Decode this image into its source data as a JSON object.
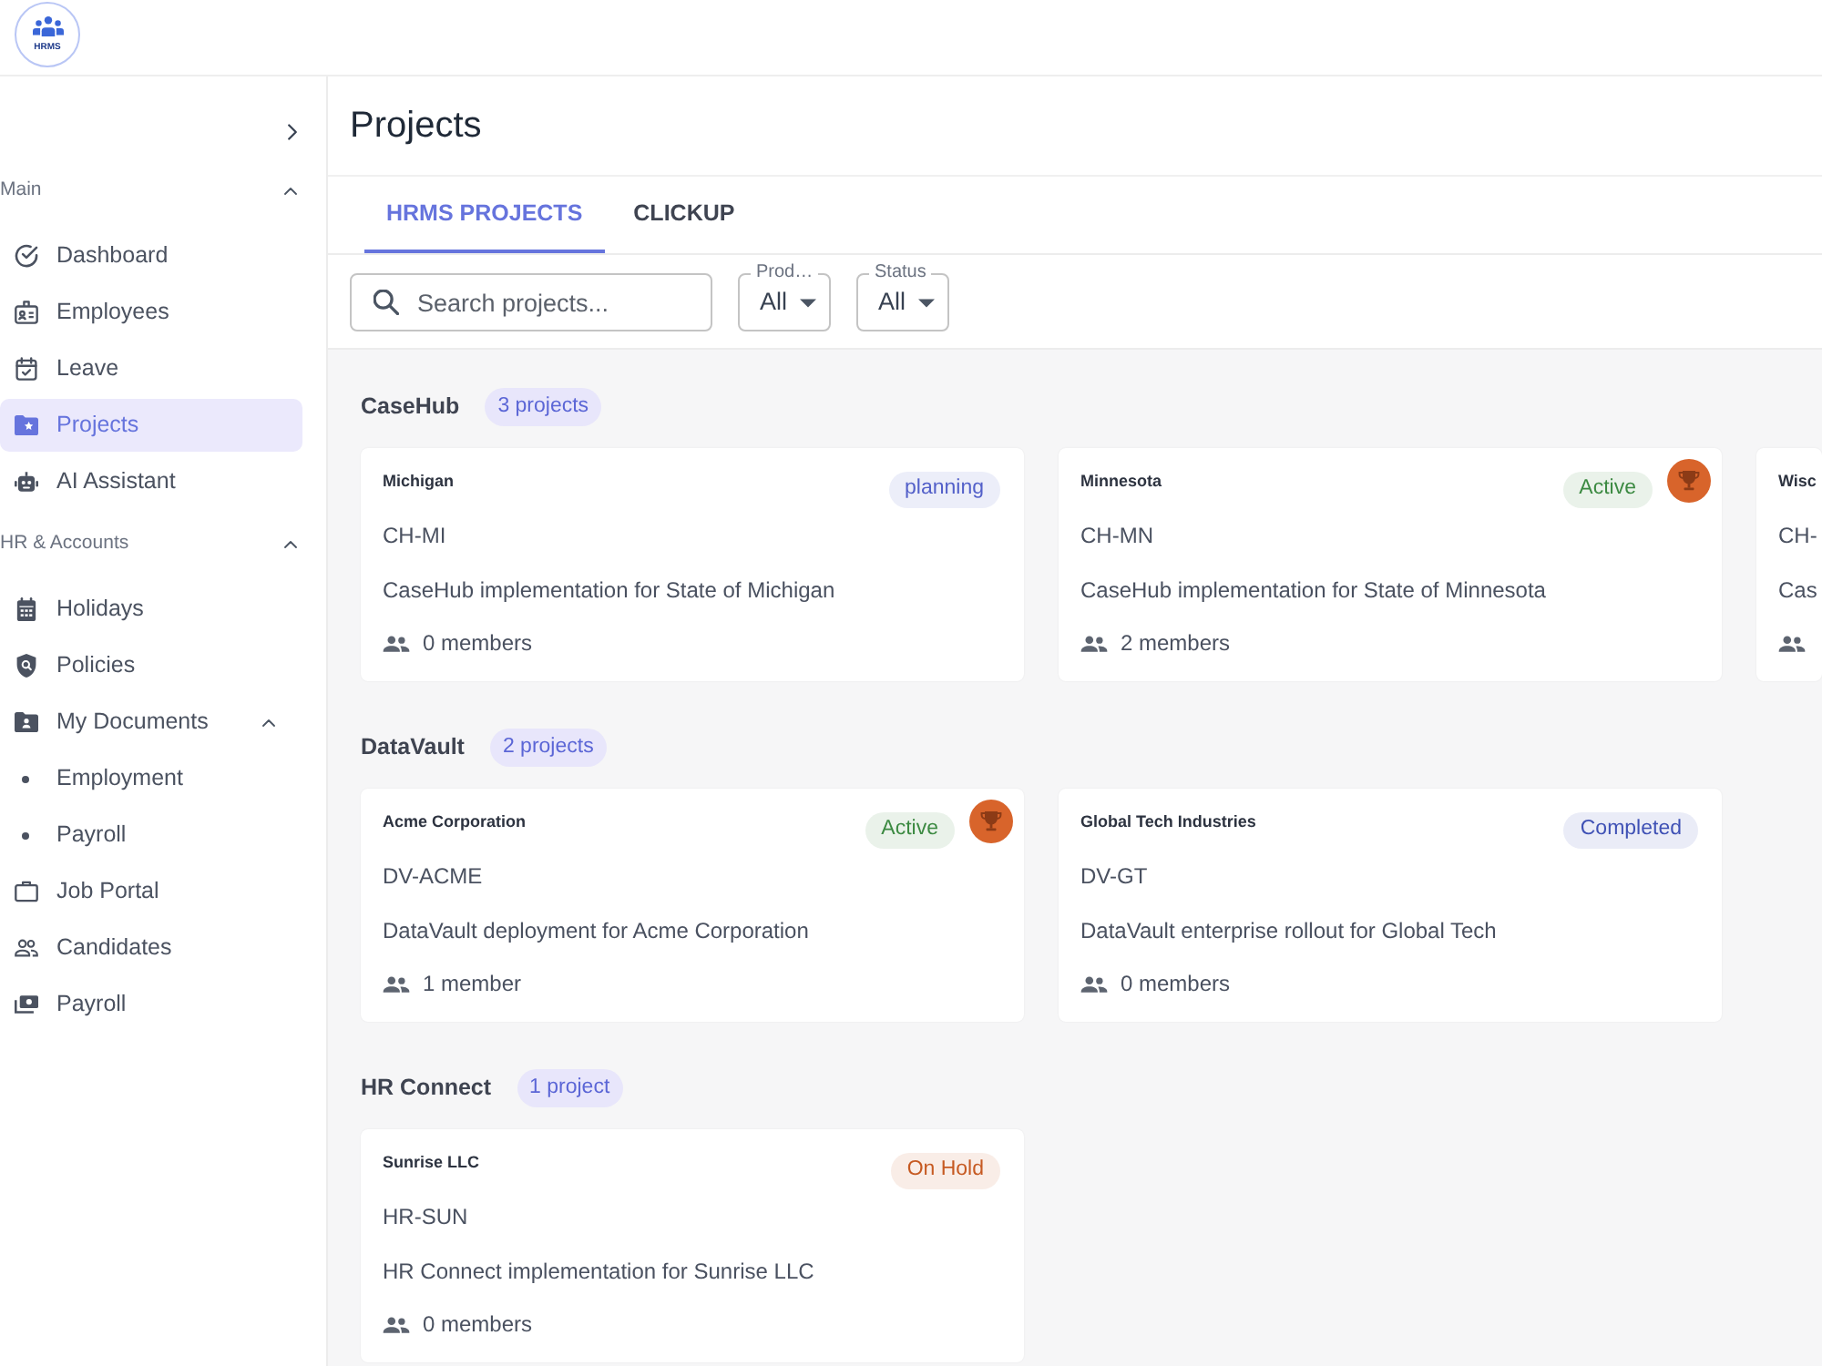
{
  "app": {
    "logo_text": "HRMS"
  },
  "sidebar": {
    "sections": [
      {
        "title": "Main",
        "expanded": true,
        "items": [
          {
            "label": "Dashboard",
            "selected": false
          },
          {
            "label": "Employees",
            "selected": false
          },
          {
            "label": "Leave",
            "selected": false
          },
          {
            "label": "Projects",
            "selected": true
          },
          {
            "label": "AI Assistant",
            "selected": false
          }
        ]
      },
      {
        "title": "HR & Accounts",
        "expanded": true,
        "items": [
          {
            "label": "Holidays",
            "selected": false
          },
          {
            "label": "Policies",
            "selected": false
          },
          {
            "label": "My Documents",
            "selected": false,
            "expanded": true,
            "children": [
              {
                "label": "Employment",
                "selected": false
              },
              {
                "label": "Payroll",
                "selected": false
              }
            ]
          },
          {
            "label": "Job Portal",
            "selected": false
          },
          {
            "label": "Candidates",
            "selected": false
          },
          {
            "label": "Payroll",
            "selected": false
          }
        ]
      }
    ]
  },
  "page": {
    "title": "Projects"
  },
  "tabs": [
    {
      "label": "HRMS PROJECTS",
      "selected": true
    },
    {
      "label": "CLICKUP",
      "selected": false
    }
  ],
  "filters": {
    "search": {
      "placeholder": "Search projects..."
    },
    "selects": [
      {
        "label": "Prod…",
        "value": "All"
      },
      {
        "label": "Status",
        "value": "All"
      }
    ]
  },
  "groups": [
    {
      "name": "CaseHub",
      "count": "3 projects",
      "projects": [
        {
          "name": "Michigan",
          "code": "CH-MI",
          "description": "CaseHub implementation for State of Michigan",
          "members": "0 members",
          "status": {
            "label": "planning",
            "color": "#5360c9"
          },
          "featured": false
        },
        {
          "name": "Minnesota",
          "code": "CH-MN",
          "description": "CaseHub implementation for State of Minnesota",
          "members": "2 members",
          "status": {
            "label": "Active",
            "color": "#3c8a42"
          },
          "featured": true
        },
        {
          "name": "Wisc",
          "code": "CH-",
          "description": "Cas",
          "featured": false
        }
      ]
    },
    {
      "name": "DataVault",
      "count": "2 projects",
      "projects": [
        {
          "name": "Acme Corporation",
          "code": "DV-ACME",
          "description": "DataVault deployment for Acme Corporation",
          "members": "1 member",
          "status": {
            "label": "Active",
            "color": "#3c8a42"
          },
          "featured": true
        },
        {
          "name": "Global Tech Industries",
          "code": "DV-GT",
          "description": "DataVault enterprise rollout for Global Tech",
          "members": "0 members",
          "status": {
            "label": "Completed",
            "color": "#3f51b5"
          },
          "featured": false
        }
      ]
    },
    {
      "name": "HR Connect",
      "count": "1 project",
      "projects": [
        {
          "name": "Sunrise LLC",
          "code": "HR-SUN",
          "description": "HR Connect implementation for Sunrise LLC",
          "members": "0 members",
          "status": {
            "label": "On Hold",
            "color": "#c65a22"
          },
          "featured": false
        }
      ]
    }
  ]
}
